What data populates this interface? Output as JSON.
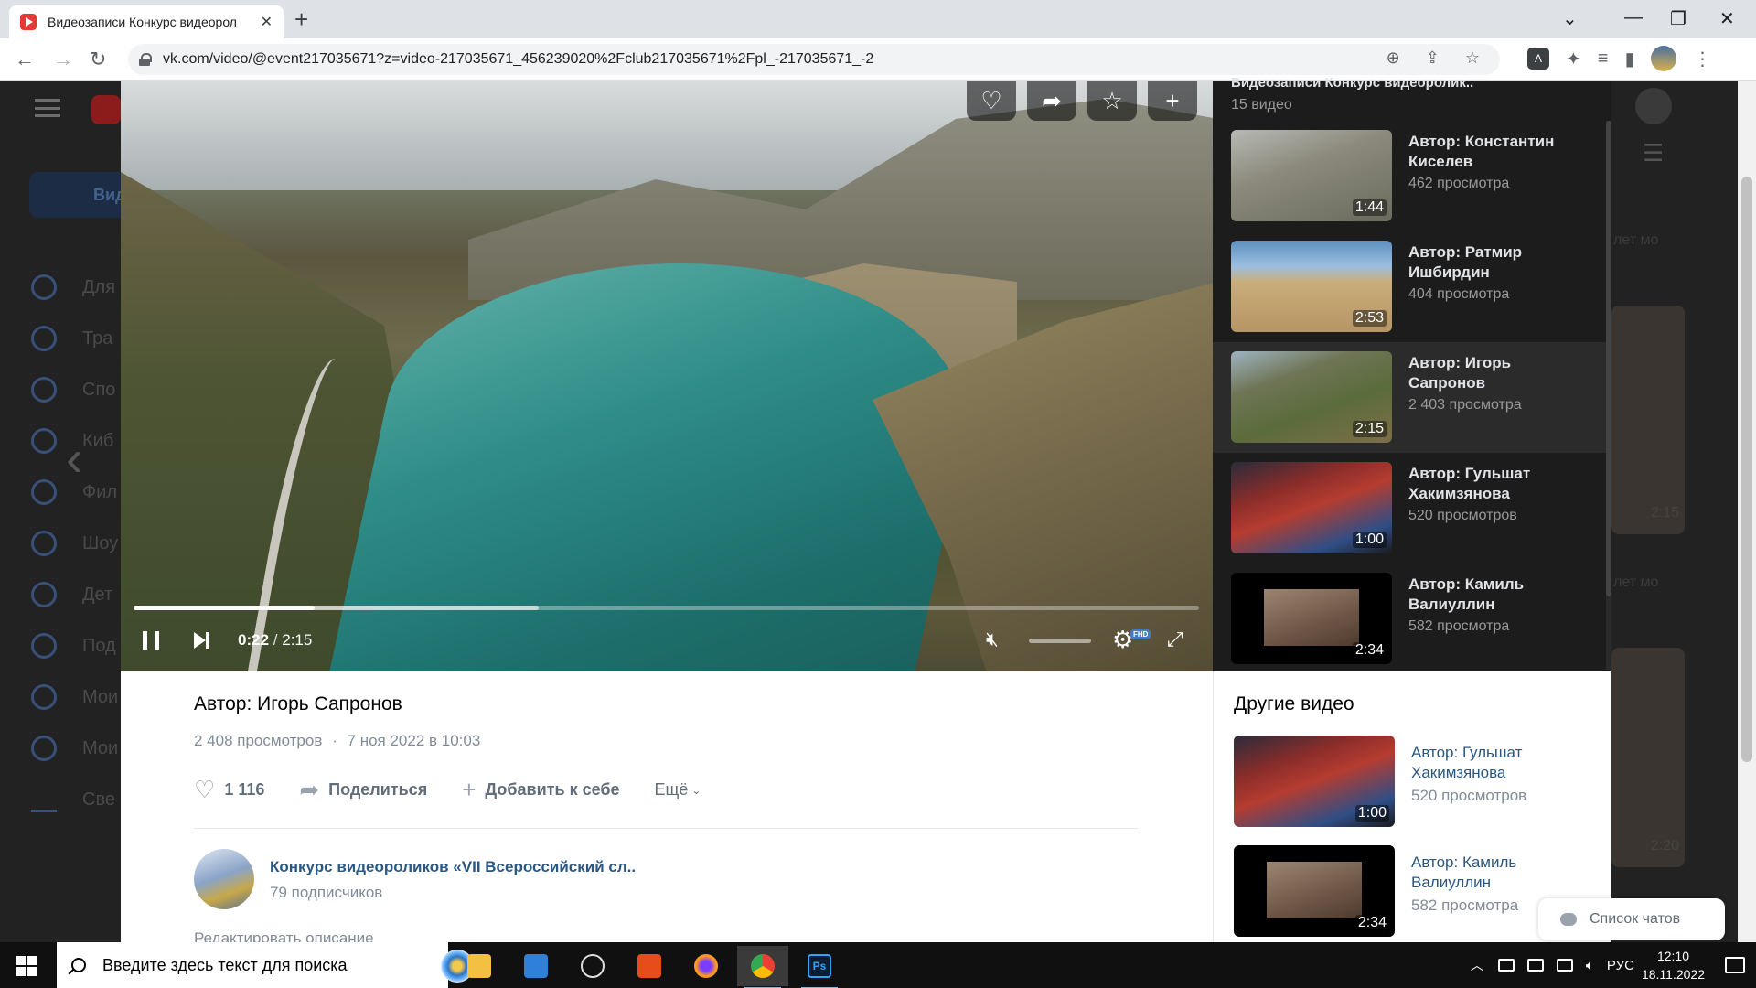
{
  "browser": {
    "tab_title": "Видеозаписи Конкурс видеорол",
    "url": "vk.com/video/@event217035671?z=video-217035671_456239020%2Fclub217035671%2Fpl_-217035671_-2"
  },
  "vk_bg": {
    "nav_active_label": "Вид",
    "nav_items": [
      "Для",
      "Тра",
      "Спо",
      "Киб",
      "Фил",
      "Шоу",
      "Дет",
      "Под",
      "Мои",
      "Мои",
      "Све"
    ],
    "right_text_1": "лет мо",
    "right_text_2": "лет мо",
    "right_dur_1": "2:15",
    "right_dur_2": "2:20"
  },
  "player": {
    "current_time": "0:22",
    "total_time": "2:15",
    "progress": 0.17,
    "buffered": 0.38,
    "quality_badge": "FHD"
  },
  "playlist": {
    "title": "Видеозаписи Конкурс видеоролик..",
    "count": "15 видео",
    "items": [
      {
        "name": "Автор: Константин Киселев",
        "views": "462 просмотра",
        "duration": "1:44",
        "thumb": "t1"
      },
      {
        "name": "Автор: Ратмир Ишбирдин",
        "views": "404 просмотра",
        "duration": "2:53",
        "thumb": "t2"
      },
      {
        "name": "Автор: Игорь Сапронов",
        "views": "2 403 просмотра",
        "duration": "2:15",
        "thumb": "t3"
      },
      {
        "name": "Автор: Гульшат Хакимзянова",
        "views": "520 просмотров",
        "duration": "1:00",
        "thumb": "t4"
      },
      {
        "name": "Автор: Камиль Валиуллин",
        "views": "582 просмотра",
        "duration": "2:34",
        "thumb": "t5"
      }
    ]
  },
  "video": {
    "title": "Автор: Игорь Сапронов",
    "views": "2 408 просмотров",
    "dot": "·",
    "date": "7 ноя 2022 в 10:03",
    "likes": "1 116",
    "share_label": "Поделиться",
    "add_label": "Добавить к себе",
    "more_label": "Ещё",
    "owner_name": "Конкурс видеороликов «VII Всероссийский сл..",
    "owner_subs": "79 подписчиков",
    "edit_description": "Редактировать описание"
  },
  "others": {
    "title": "Другие видео",
    "items": [
      {
        "name": "Автор: Гульшат Хакимзянова",
        "views": "520 просмотров",
        "duration": "1:00"
      },
      {
        "name": "Автор: Камиль Валиуллин",
        "views": "582 просмотра",
        "duration": "2:34"
      }
    ]
  },
  "chat_list": "Список чатов",
  "taskbar": {
    "search_placeholder": "Введите здесь текст для поиска",
    "lang": "РУС",
    "time": "12:10",
    "date": "18.11.2022"
  }
}
